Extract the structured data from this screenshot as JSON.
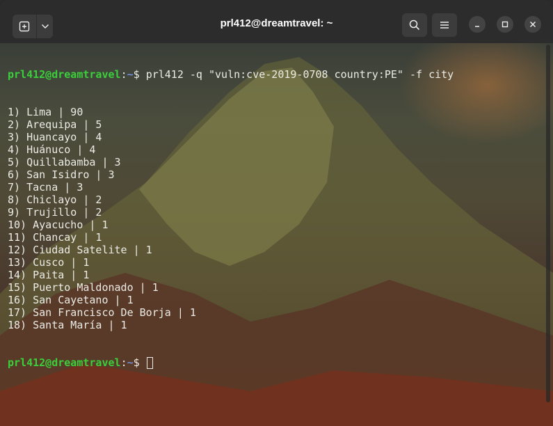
{
  "window": {
    "title": "prl412@dreamtravel: ~"
  },
  "icons": {
    "new_tab": "new-tab-icon",
    "dropdown": "chevron-down-icon",
    "search": "search-icon",
    "menu": "hamburger-menu-icon",
    "minimize": "minimize-icon",
    "maximize": "maximize-icon",
    "close": "close-icon"
  },
  "colors": {
    "prompt_user": "#3bd03b",
    "prompt_path": "#6f8fdc",
    "text": "#ecece6",
    "titlebar": "#2c2c2c"
  },
  "terminal": {
    "prompt_user": "prl412@dreamtravel",
    "prompt_sep": ":",
    "prompt_path": "~",
    "prompt_symbol": "$ ",
    "command": "prl412 -q \"vuln:cve-2019-0708 country:PE\" -f city",
    "output": [
      "1) Lima | 90",
      "2) Arequipa | 5",
      "3) Huancayo | 4",
      "4) Huánuco | 4",
      "5) Quillabamba | 3",
      "6) San Isidro | 3",
      "7) Tacna | 3",
      "8) Chiclayo | 2",
      "9) Trujillo | 2",
      "10) Ayacucho | 1",
      "11) Chancay | 1",
      "12) Ciudad Satelite | 1",
      "13) Cusco | 1",
      "14) Paita | 1",
      "15) Puerto Maldonado | 1",
      "16) San Cayetano | 1",
      "17) San Francisco De Borja | 1",
      "18) Santa María | 1"
    ]
  }
}
